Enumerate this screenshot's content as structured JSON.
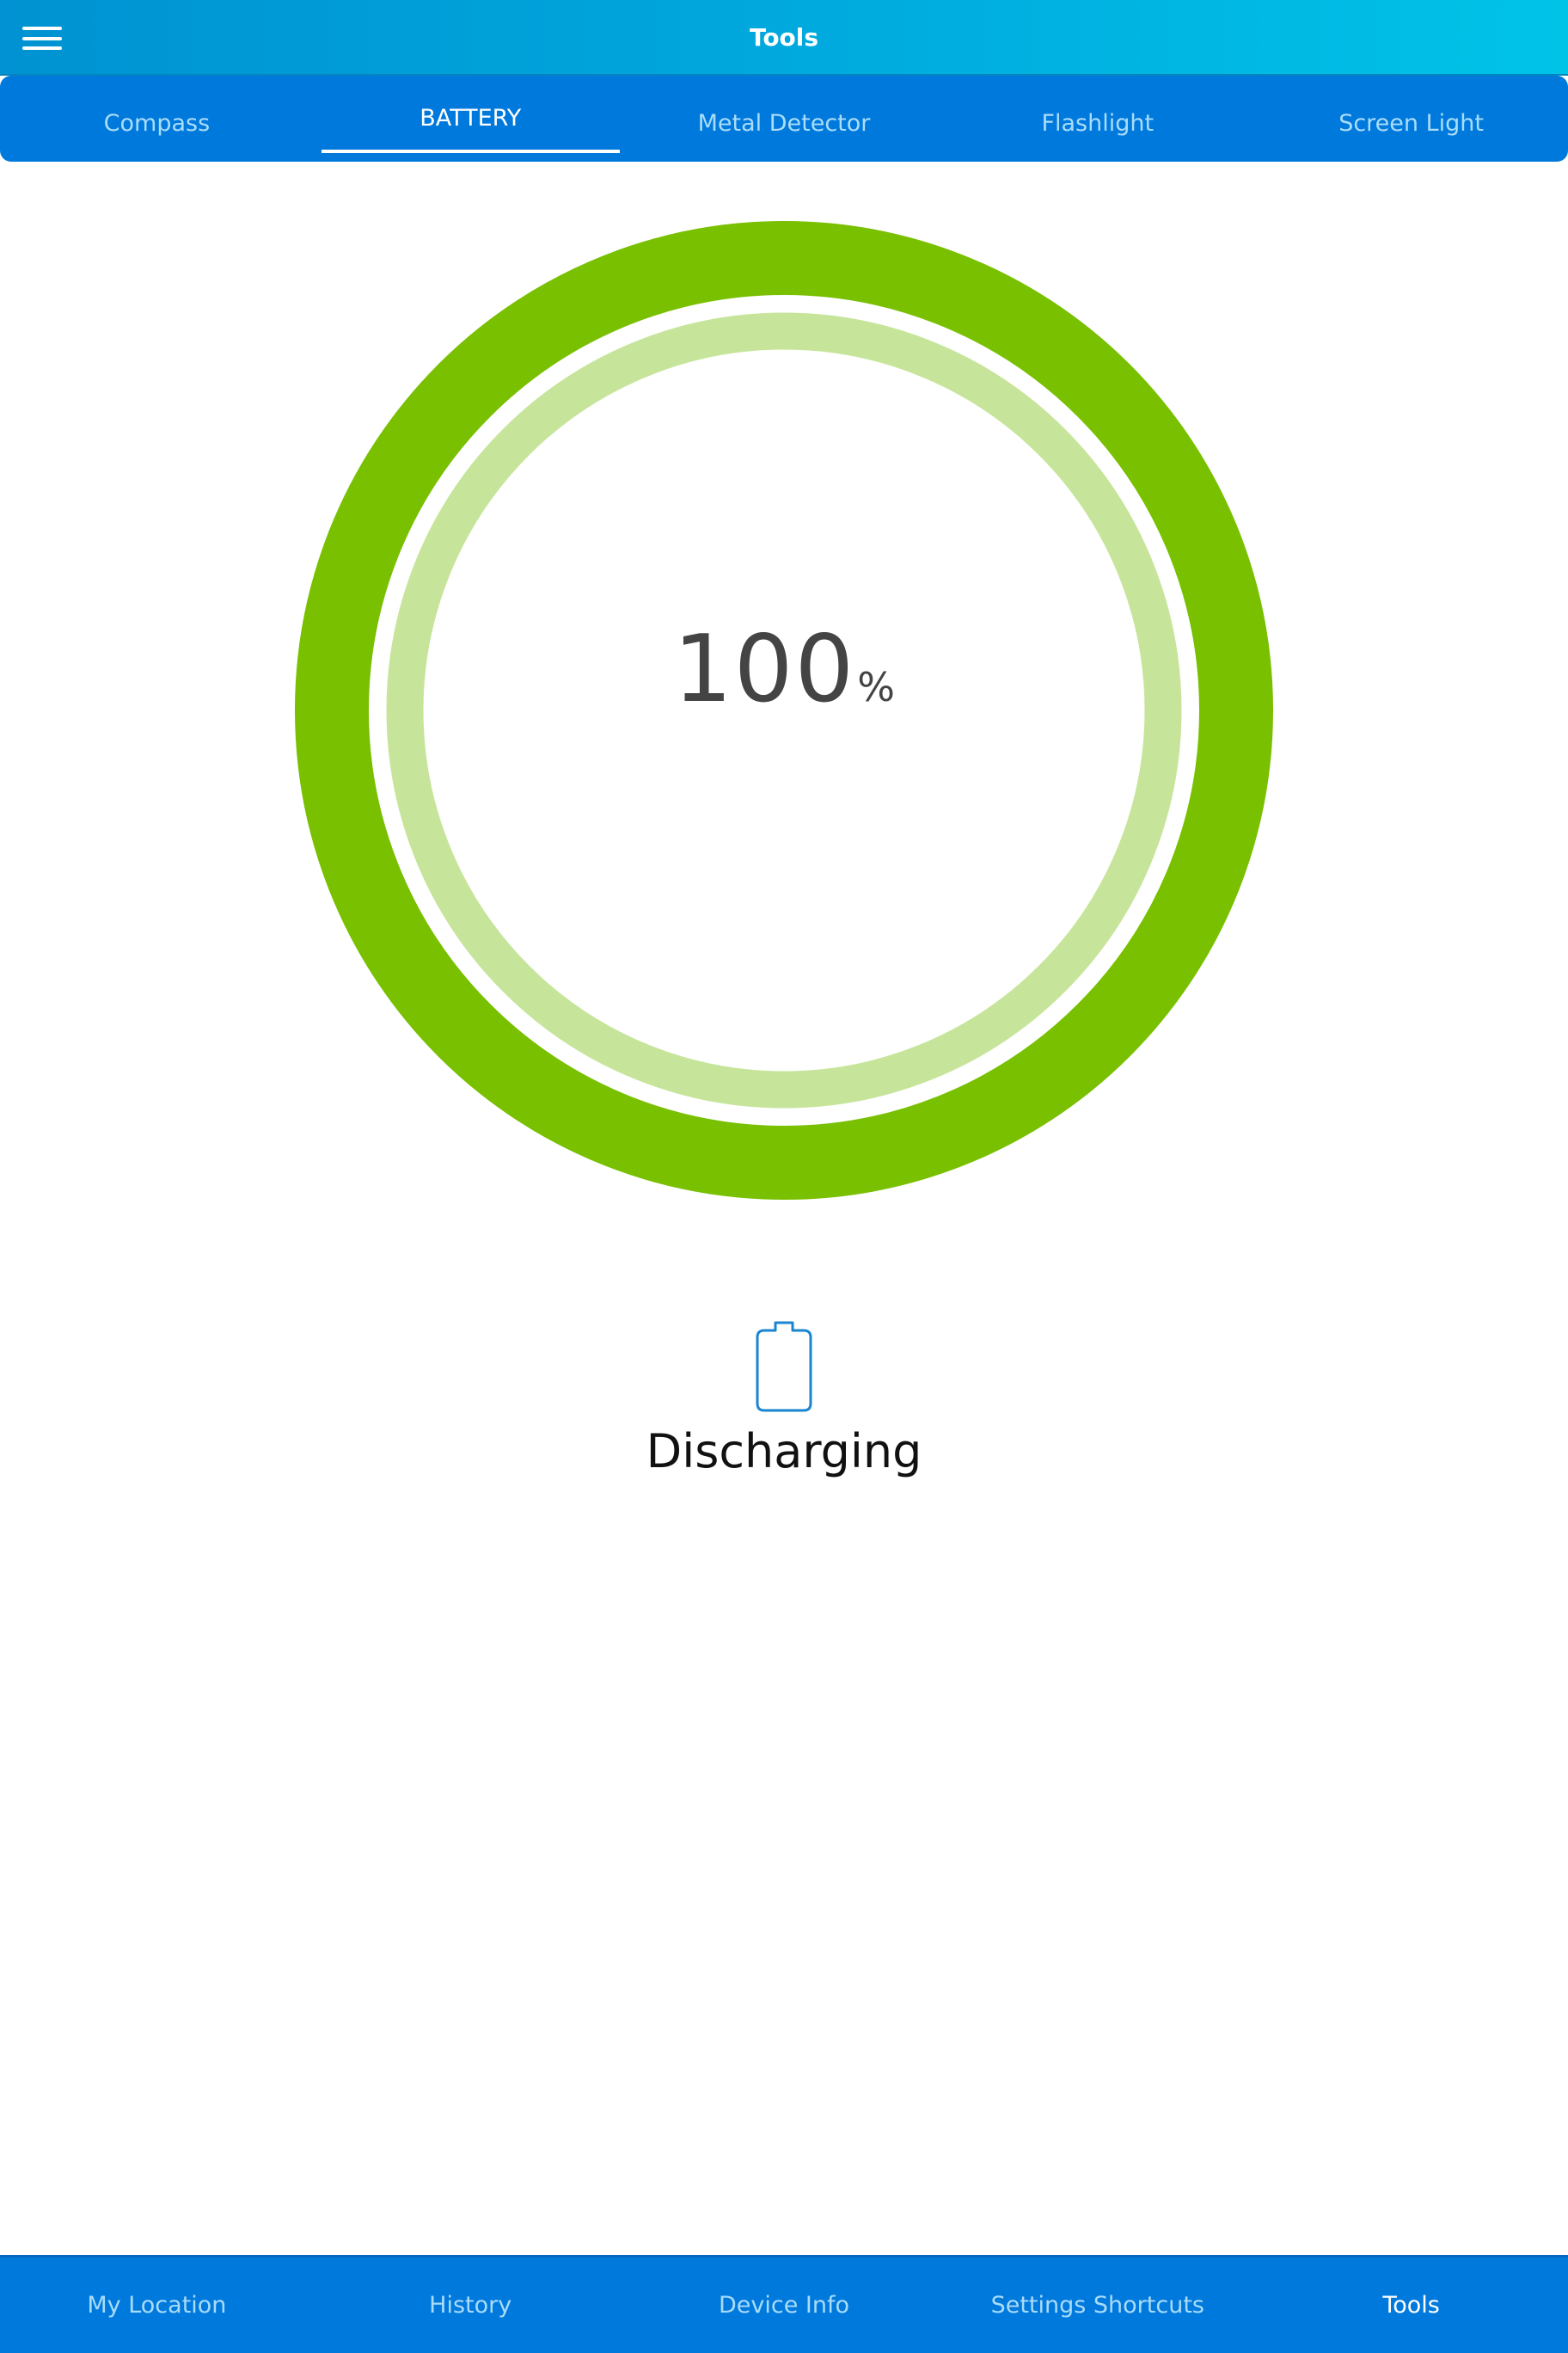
{
  "header": {
    "title": "Tools",
    "menu_icon": "hamburger-menu-icon"
  },
  "tabs": [
    {
      "label": "Compass",
      "active": false
    },
    {
      "label": "BATTERY",
      "active": true
    },
    {
      "label": "Metal Detector",
      "active": false
    },
    {
      "label": "Flashlight",
      "active": false
    },
    {
      "label": "Screen Light",
      "active": false
    }
  ],
  "battery": {
    "level_percent": 100,
    "value_text": "100",
    "unit": "%",
    "status": "Discharging",
    "status_icon": "battery-outline-icon",
    "ring_color": "#78c000",
    "inner_ring_color": "#c6e59a"
  },
  "bottom_nav": [
    {
      "label": "My Location",
      "active": false
    },
    {
      "label": "History",
      "active": false
    },
    {
      "label": "Device Info",
      "active": false
    },
    {
      "label": "Settings Shortcuts",
      "active": false
    },
    {
      "label": "Tools",
      "active": true
    }
  ],
  "colors": {
    "primary": "#0079dd",
    "header_start": "#0092d2",
    "header_end": "#00c3e8",
    "inactive_text": "#a8dcf9",
    "battery_icon": "#1a86d0"
  }
}
